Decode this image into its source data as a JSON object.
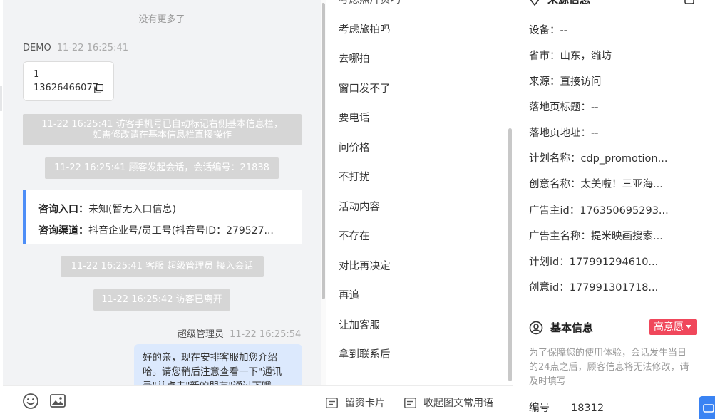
{
  "chat": {
    "no_more": "没有更多了",
    "customer": {
      "name": "DEMO",
      "time": "11-22 16:25:41",
      "msg_line1": "1",
      "msg_line2": "13626466077"
    },
    "sys_notes": {
      "auto_mark_line1": "11-22 16:25:41 访客手机号已自动标记右侧基本信息栏，",
      "auto_mark_line2": "如需修改请在基本信息栏直接操作",
      "session_start": "11-22 16:25:41 顾客发起会话，会话编号：21838",
      "agent_join": "11-22 16:25:41 客服 超级管理员 接入会话",
      "visitor_left": "11-22 16:25:42 访客已离开"
    },
    "entry_card": {
      "entry_label": "咨询入口：",
      "entry_value": "未知(暂无入口信息)",
      "channel_label": "咨询渠道：",
      "channel_value": "抖音企业号/员工号(抖音号ID：279527..."
    },
    "agent": {
      "name": "超级管理员",
      "time": "11-22 16:25:54",
      "msg": "好的亲，现在安排客服加您介绍哈。请您稍后注意查看一下\"通讯录\"并点击\"新的朋友\"通过下哦"
    },
    "toolbar": {
      "emoji_icon": "smile-icon",
      "image_icon": "image-icon"
    }
  },
  "phrases": {
    "top_partial": "考虑照片贵吗",
    "items": [
      "考虑旅拍吗",
      "去哪拍",
      "窗口发不了",
      "要电话",
      "问价格",
      "不打扰",
      "活动内容",
      "不存在",
      "对比再决定",
      "再追",
      "让加客服",
      "拿到联系后"
    ],
    "footer": {
      "card_label": "留资卡片",
      "collapse_label": "收起图文常用语"
    }
  },
  "info": {
    "source": {
      "title": "来源信息",
      "rows": [
        "设备：--",
        "省市：山东，潍坊",
        "来源：直接访问",
        "落地页标题：--",
        "落地页地址：--",
        "计划名称：cdp_promotion...",
        "创意名称：太美啦！三亚海...",
        "广告主id：176350695293...",
        "广告主名称：提米映画搜索...",
        "计划id：177991294610...",
        "创意id：177991301718..."
      ]
    },
    "basic": {
      "title": "基本信息",
      "intent_badge": "高意愿",
      "notice": "为了保障您的使用体验，会话发生当日的24点之后，顾客信息将无法修改，请及时填写",
      "id_label": "编号",
      "id_value": "18312"
    }
  },
  "colors": {
    "accent": "#4e8ef7",
    "badge": "#f0475b",
    "agent_bubble": "#dce9fd",
    "sys_note": "#d6d6d6"
  }
}
